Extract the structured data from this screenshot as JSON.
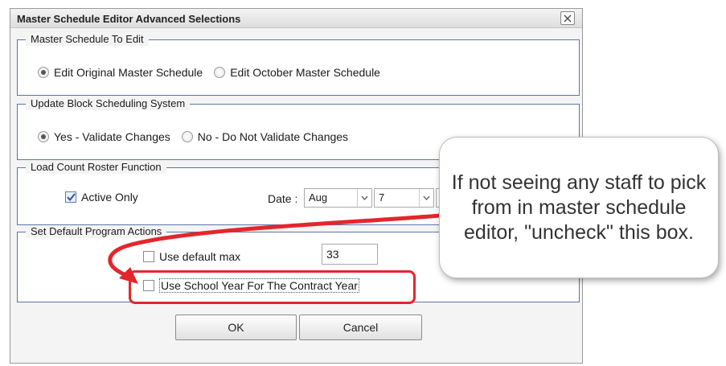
{
  "dialog": {
    "title": "Master Schedule Editor Advanced Selections",
    "close_glyph": "✕"
  },
  "sections": {
    "master": {
      "legend": "Master Schedule To Edit",
      "options": [
        "Edit Original Master Schedule",
        "Edit October Master Schedule"
      ],
      "selected": 0
    },
    "block": {
      "legend": "Update Block Scheduling System",
      "options": [
        "Yes - Validate Changes",
        "No - Do Not Validate Changes"
      ],
      "selected": 0
    },
    "load_count": {
      "legend": "Load Count Roster Function",
      "active_only_label": "Active Only",
      "active_only_checked": true,
      "date_label": "Date :",
      "month": "Aug",
      "day": "7"
    },
    "program": {
      "legend": "Set Default Program Actions",
      "use_default_max_label": "Use default max",
      "use_default_max_checked": false,
      "default_max_value": "33",
      "school_year_label": "Use School Year For The Contract Year",
      "school_year_checked": false
    }
  },
  "buttons": {
    "ok_label": "OK",
    "cancel_label": "Cancel"
  },
  "annotation": {
    "callout_text": "If not seeing any staff to pick from in master schedule editor, \"uncheck\" this box.",
    "highlight_color": "#e4262c"
  }
}
